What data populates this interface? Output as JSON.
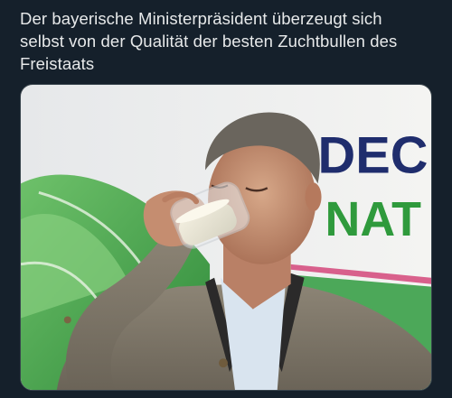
{
  "tweet": {
    "text": "Der bayerische Ministerpräsident überzeugt sich selbst von der Qualität der besten Zuchtbullen des Freistaats"
  },
  "media": {
    "banner_line1": "DEC",
    "banner_line2": "NAT"
  },
  "colors": {
    "background": "#15202b",
    "text": "#e7e9ea",
    "banner_navy": "#1f2d6d",
    "banner_green": "#2f9a3c"
  }
}
